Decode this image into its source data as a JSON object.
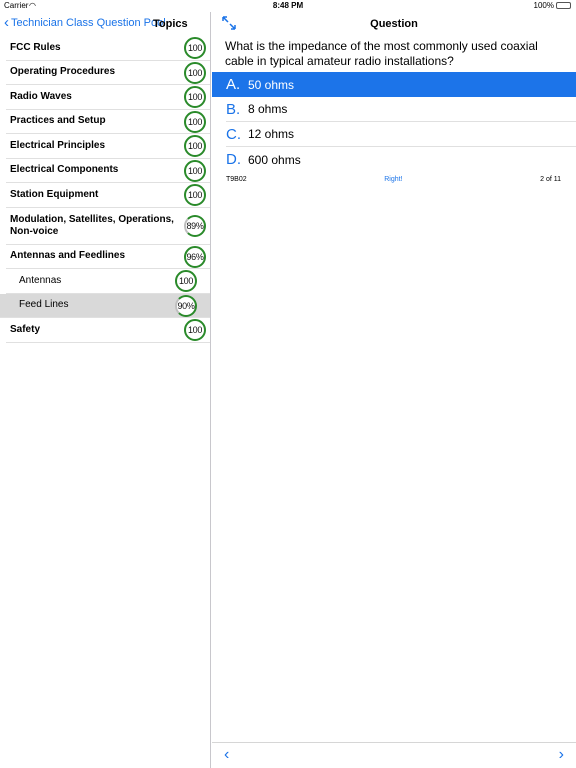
{
  "status": {
    "carrier": "Carrier",
    "time": "8:48 PM",
    "battery": "100%"
  },
  "master": {
    "back_label": "Technician Class Question Pool",
    "title": "Topics",
    "topics": [
      {
        "label": "FCC Rules",
        "score": "100"
      },
      {
        "label": "Operating Procedures",
        "score": "100"
      },
      {
        "label": "Radio Waves",
        "score": "100"
      },
      {
        "label": "Practices and Setup",
        "score": "100"
      },
      {
        "label": "Electrical Principles",
        "score": "100"
      },
      {
        "label": "Electrical Components",
        "score": "100"
      },
      {
        "label": "Station Equipment",
        "score": "100"
      },
      {
        "label": "Modulation, Satellites, Operations, Non-voice",
        "score": "89%"
      },
      {
        "label": "Antennas and Feedlines",
        "score": "96%"
      },
      {
        "label": "Antennas",
        "score": "100"
      },
      {
        "label": "Feed Lines",
        "score": "90%"
      },
      {
        "label": "Safety",
        "score": "100"
      }
    ]
  },
  "detail": {
    "title": "Question",
    "question": "What is the impedance of the most commonly used coaxial cable in typical amateur radio installations?",
    "answers": [
      {
        "letter": "A.",
        "text": "50 ohms"
      },
      {
        "letter": "B.",
        "text": "8 ohms"
      },
      {
        "letter": "C.",
        "text": "12 ohms"
      },
      {
        "letter": "D.",
        "text": "600 ohms"
      }
    ],
    "question_id": "T9B02",
    "result": "Right!",
    "position": "2 of 11"
  }
}
